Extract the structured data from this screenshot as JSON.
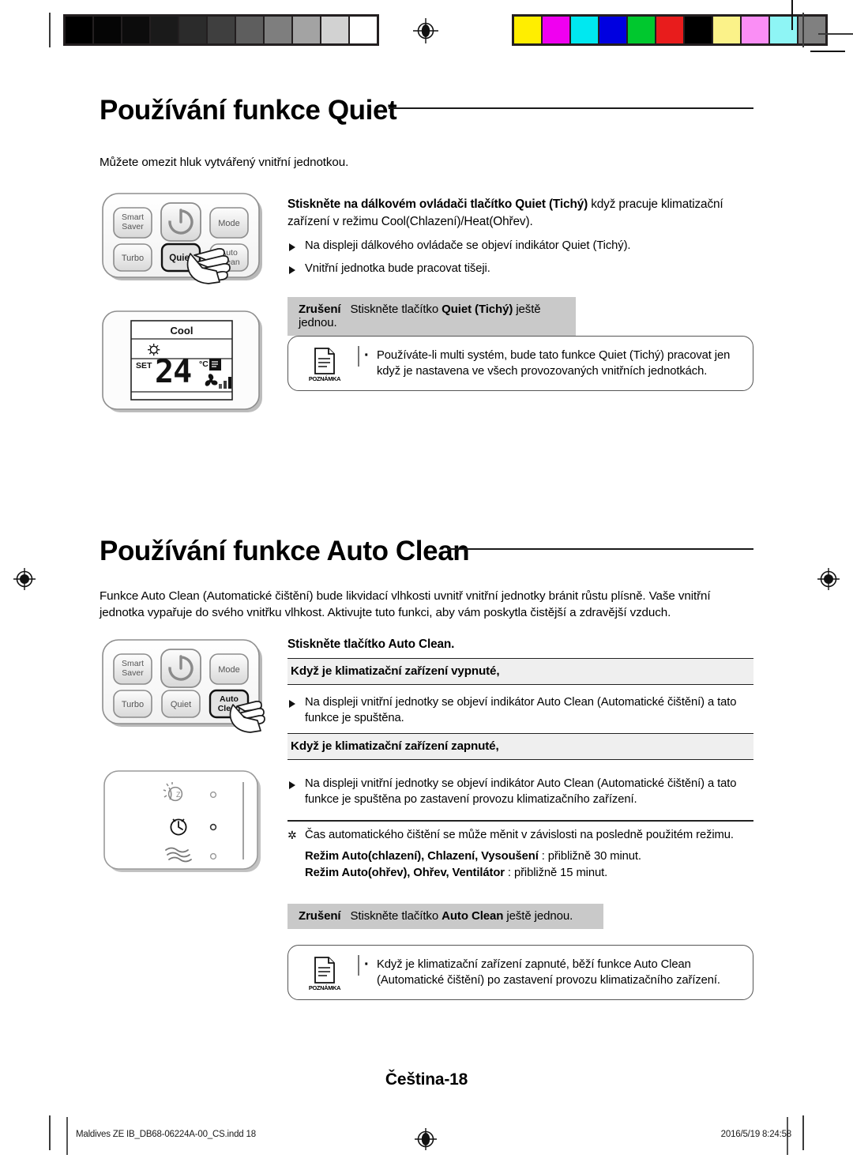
{
  "document": {
    "language": "Czech",
    "page_label": "Čeština-18"
  },
  "calibration": {
    "grayscale_patches": [
      "#000000",
      "#050505",
      "#0c0c0c",
      "#1a1a1a",
      "#2b2b2b",
      "#3f3f3f",
      "#5e5e5e",
      "#7e7e7e",
      "#a3a3a3",
      "#d2d2d2",
      "#ffffff"
    ],
    "color_patches": [
      "#ffee00",
      "#f000f0",
      "#00e8f0",
      "#0000e0",
      "#00c82e",
      "#e81c1c",
      "#000000",
      "#fbf289",
      "#fa8ef5",
      "#8ef5f5",
      "#808080"
    ]
  },
  "section_quiet": {
    "title": "Používání funkce Quiet",
    "intro": "Můžete omezit hluk vytvářený vnitřní jednotkou.",
    "lead_a": "Stiskněte na dálkovém ovládači tlačítko ",
    "lead_bold": "Quiet (Tichý)",
    "lead_b": " když pracuje klimatizační zařízení v režimu Cool(Chlazení)/Heat(Ohřev).",
    "bullets": [
      "Na displeji dálkového ovládače se objeví indikátor Quiet (Tichý).",
      "Vnitřní jednotka bude pracovat tišeji."
    ],
    "cancel": {
      "label": "Zrušení",
      "text_a": "Stiskněte tlačítko ",
      "text_bold": "Quiet (Tichý)",
      "text_b": " ještě jednou."
    },
    "note": {
      "caption": "POZNÁMKA",
      "text": "Používáte-li multi systém, bude tato funkce Quiet (Tichý) pracovat jen když je nastavena ve všech provozovaných vnitřních jednotkách."
    },
    "remote": {
      "buttons": [
        "Smart Saver",
        "Mode",
        "Turbo",
        "Quiet",
        "Auto Clean"
      ],
      "pressed": "Quiet",
      "power_icon": "power-icon"
    },
    "lcd": {
      "mode": "Cool",
      "set_label": "SET",
      "temperature": "24",
      "unit": "°C",
      "icons": [
        "cool-snowflake-icon",
        "quiet-indicator-icon",
        "fan-icon",
        "fan-speed-bars-icon"
      ]
    }
  },
  "section_autoclean": {
    "title": "Používání funkce Auto Clean",
    "intro": "Funkce Auto Clean (Automatické čištění) bude likvidací vlhkosti uvnitř vnitřní jednotky bránit růstu plísně. Vaše vnitřní jednotka vypařuje do svého vnitřku vlhkost. Aktivujte tuto funkci, aby vám poskytla čistější a zdravější vzduch.",
    "lead_a": "Stiskněte tlačítko ",
    "lead_bold": "Auto Clean.",
    "subsection_off": {
      "heading": "Když je klimatizační zařízení vypnuté,",
      "bullet": "Na displeji vnitřní jednotky se objeví indikátor Auto Clean (Automatické čištění) a tato funkce je spuštěna."
    },
    "subsection_on": {
      "heading": "Když je klimatizační zařízení zapnuté,",
      "bullet": "Na displeji vnitřní jednotky se objeví indikátor Auto Clean (Automatické čištění) a tato funkce je spuštěna po zastavení provozu klimatizačního zařízení."
    },
    "star_note": "Čas automatického čištění se může měnit v závislosti na posledně použitém režimu.",
    "mode_line_1_bold": "Režim Auto(chlazení), Chlazení, Vysoušení",
    "mode_line_1_rest": " : přibližně 30 minut.",
    "mode_line_2_bold": "Režim Auto(ohřev), Ohřev, Ventilátor",
    "mode_line_2_rest": " : přibližně 15 minut.",
    "cancel": {
      "label": "Zrušení",
      "text_a": "Stiskněte tlačítko ",
      "text_bold": "Auto Clean",
      "text_b": " ještě jednou."
    },
    "note": {
      "caption": "POZNÁMKA",
      "text": "Když je klimatizační zařízení zapnuté, běží funkce Auto Clean (Automatické čištění) po zastavení provozu klimatizačního zařízení."
    },
    "remote": {
      "buttons": [
        "Smart Saver",
        "Mode",
        "Turbo",
        "Quiet",
        "Auto Clean"
      ],
      "pressed": "Auto Clean",
      "power_icon": "power-icon"
    },
    "indoor_unit": {
      "icons": [
        "day-night-icon",
        "timer-clock-icon",
        "airflow-waves-icon"
      ],
      "leds": 3
    }
  },
  "footer": {
    "file_info": "Maldives ZE IB_DB68-06224A-00_CS.indd   18",
    "timestamp": "2016/5/19   8:24:58"
  }
}
